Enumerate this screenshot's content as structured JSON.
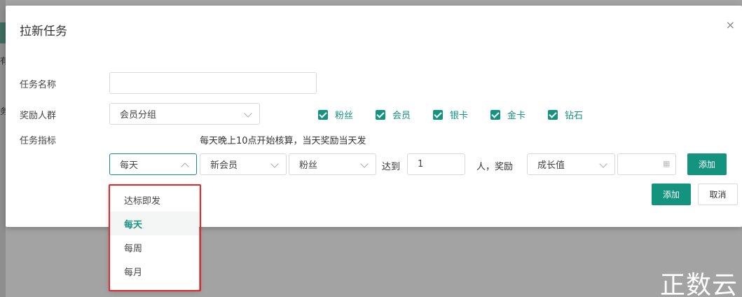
{
  "background": {
    "peek_text_1": "有",
    "peek_text_2": "务"
  },
  "modal": {
    "title": "拉新任务",
    "close_symbol": "×"
  },
  "form": {
    "task_name": {
      "label": "任务名称",
      "value": "",
      "placeholder": ""
    },
    "reward_group": {
      "label": "奖励人群",
      "select_value": "会员分组",
      "checkboxes": [
        {
          "label": "粉丝",
          "checked": true
        },
        {
          "label": "会员",
          "checked": true
        },
        {
          "label": "银卡",
          "checked": true
        },
        {
          "label": "金卡",
          "checked": true
        },
        {
          "label": "钻石",
          "checked": true
        }
      ]
    },
    "task_metric": {
      "label": "任务指标",
      "hint": "每天晚上10点开始核算，当天奖励当天发",
      "frequency_value": "每天",
      "member_type_value": "新会员",
      "audience_value": "粉丝",
      "reach_label": "达到",
      "count_value": "1",
      "reward_label": "人，奖励",
      "reward_type_value": "成长值",
      "reward_amount_value": "",
      "row_add_button": "添加"
    },
    "add_button": "添加",
    "cancel_button": "取消"
  },
  "frequency_dropdown": {
    "options": [
      "达标即发",
      "每天",
      "每周",
      "每月"
    ],
    "selected": "每天"
  },
  "watermark": "正数云",
  "colors": {
    "accent": "#14937f",
    "highlight": "#e5262b"
  },
  "icons": {
    "close": "close-icon",
    "chevron": "chevron-down-icon",
    "calculator": "calculator-icon"
  }
}
